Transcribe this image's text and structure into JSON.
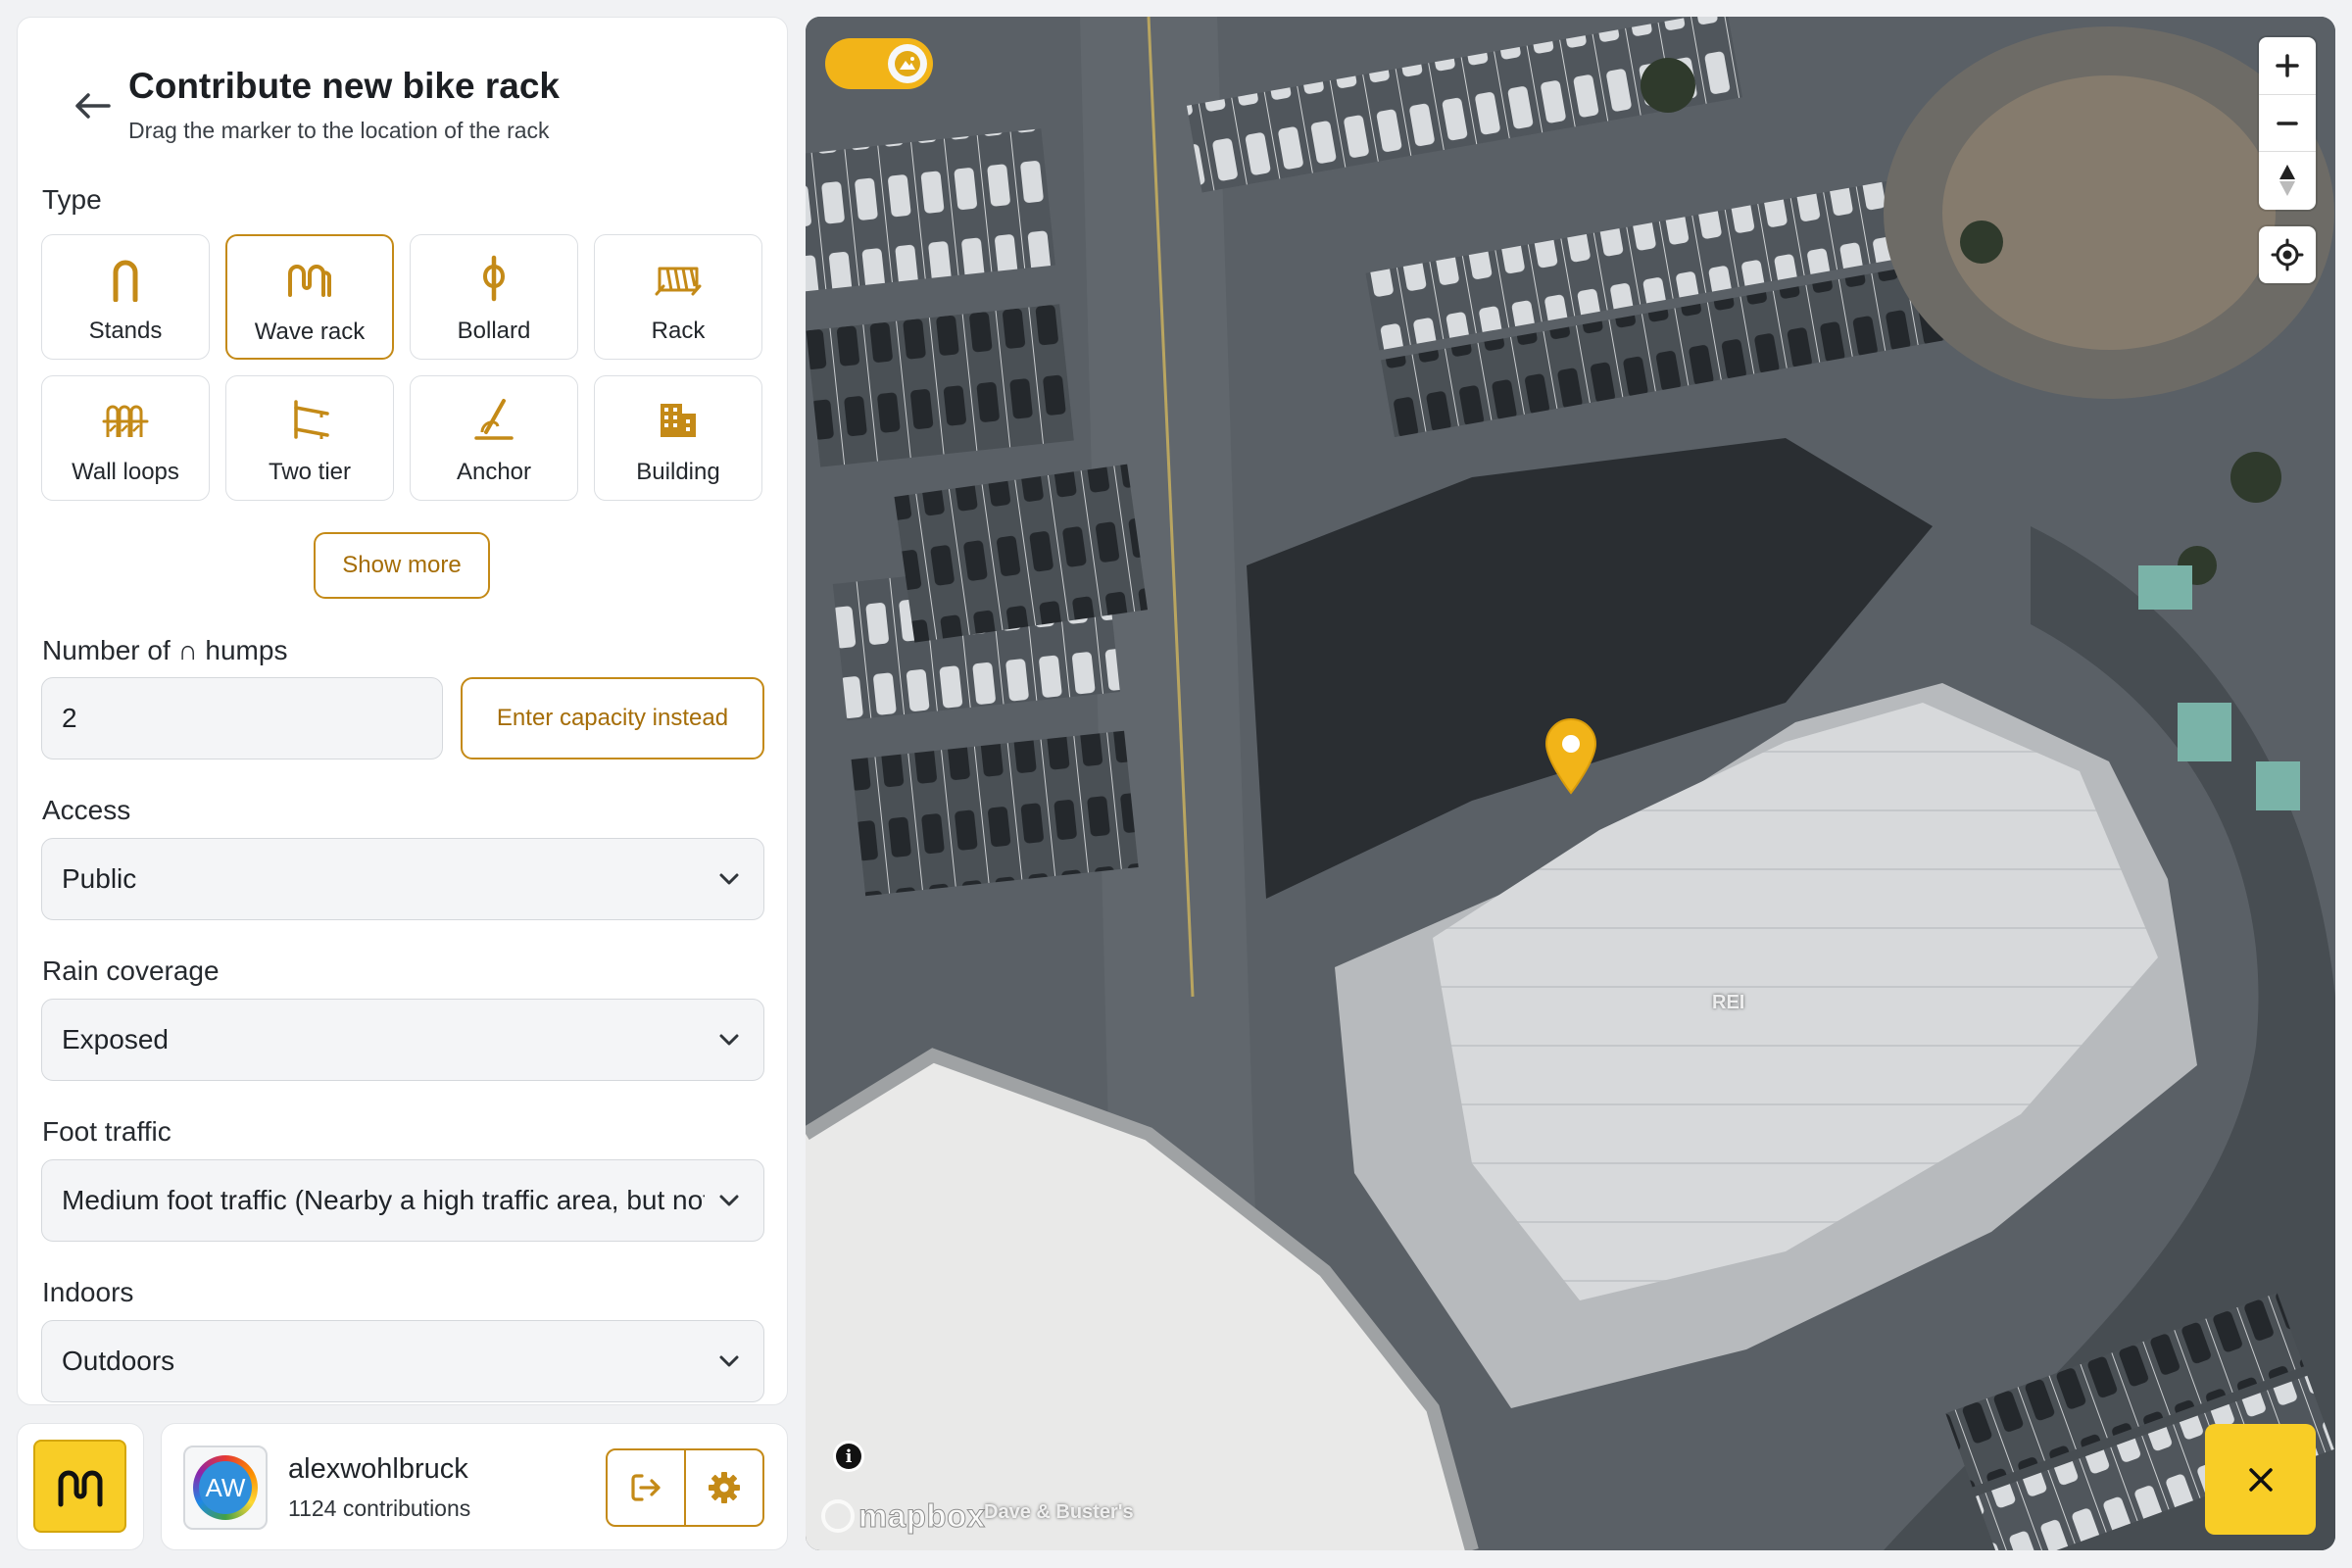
{
  "header": {
    "title": "Contribute new bike rack",
    "subtitle": "Drag the marker to the location of the rack",
    "back_icon": "arrow-left-icon"
  },
  "type_section": {
    "label": "Type",
    "options": [
      {
        "label": "Stands",
        "icon": "stands-icon",
        "selected": false
      },
      {
        "label": "Wave rack",
        "icon": "wave-rack-icon",
        "selected": true
      },
      {
        "label": "Bollard",
        "icon": "bollard-icon",
        "selected": false
      },
      {
        "label": "Rack",
        "icon": "rack-icon",
        "selected": false
      },
      {
        "label": "Wall loops",
        "icon": "wall-loops-icon",
        "selected": false
      },
      {
        "label": "Two tier",
        "icon": "two-tier-icon",
        "selected": false
      },
      {
        "label": "Anchor",
        "icon": "anchor-icon",
        "selected": false
      },
      {
        "label": "Building",
        "icon": "building-icon",
        "selected": false
      }
    ],
    "show_more_label": "Show more"
  },
  "humps": {
    "label": "Number of ∩ humps",
    "value": "2",
    "capacity_button": "Enter capacity instead"
  },
  "access": {
    "label": "Access",
    "value": "Public"
  },
  "rain": {
    "label": "Rain coverage",
    "value": "Exposed"
  },
  "foot_traffic": {
    "label": "Foot traffic",
    "value": "Medium foot traffic (Nearby a high traffic area, but not directly in it)"
  },
  "indoors": {
    "label": "Indoors",
    "value": "Outdoors"
  },
  "user": {
    "avatar_initials": "AW",
    "username": "alexwohlbruck",
    "contributions": "1124 contributions",
    "logout_icon": "logout-icon",
    "settings_icon": "gear-icon"
  },
  "map": {
    "style_toggle_icon": "satellite-image-icon",
    "zoom_in_icon": "plus-icon",
    "zoom_out_icon": "minus-icon",
    "compass_icon": "compass-icon",
    "locate_icon": "locate-icon",
    "attribution_icon": "info-icon",
    "attribution_label": "i",
    "mapbox_logo": "mapbox",
    "poi_labels": [
      "REI",
      "Dave & Buster's"
    ],
    "marker_color": "#f2b418"
  },
  "colors": {
    "accent": "#c48a17",
    "accent_text": "#a56d07",
    "brand_yellow": "#f8cd26"
  }
}
